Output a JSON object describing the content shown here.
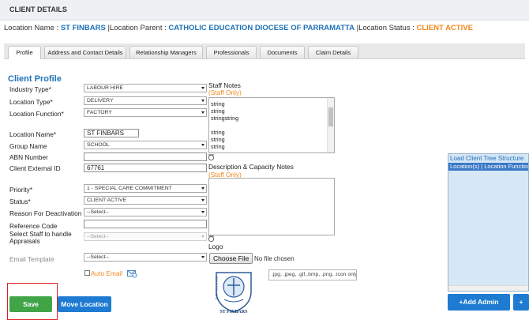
{
  "header": {
    "title": "CLIENT DETAILS"
  },
  "location_line": {
    "name_label": "Location Name : ",
    "name_value": "ST FINBARS",
    "parent_label": "|Location Parent : ",
    "parent_value": "CATHOLIC EDUCATION DIOCESE OF PARRAMATTA",
    "status_label": "|Location Status : ",
    "status_value": "CLIENT ACTIVE"
  },
  "tabs": [
    "Profile",
    "Address and Contact Details",
    "Relationship Managers",
    "Professionals",
    "Documents",
    "Claim Details"
  ],
  "section_title": "Client Profile",
  "fields": {
    "industry_type": {
      "label": "Industry Type*",
      "value": "LABOUR HIRE"
    },
    "location_type": {
      "label": "Location Type*",
      "value": "DELIVERY"
    },
    "location_function": {
      "label": "Location Function*",
      "value": "FACTORY"
    },
    "location_name": {
      "label": "Location Name*",
      "value": "ST FINBARS"
    },
    "group_name": {
      "label": "Group Name",
      "value": "SCHOOL"
    },
    "abn_number": {
      "label": "ABN Number",
      "value": ""
    },
    "client_external_id": {
      "label": "Client External ID",
      "value": "67761"
    },
    "priority": {
      "label": "Priority*",
      "value": "1 - SPECIAL CARE COMMITMENT"
    },
    "status": {
      "label": "Status*",
      "value": "CLIENT ACTIVE"
    },
    "reason_for_deactivation": {
      "label": "Reason For Deactivation",
      "value": "--Select--"
    },
    "reference_code": {
      "label": "Reference Code",
      "value": ""
    },
    "staff_appraisals": {
      "label_line1": "Select Staff to handle",
      "label_line2": "Appraisals",
      "value": "--Select--"
    },
    "email_template": {
      "label": "Email Template",
      "value": "--Select--"
    },
    "auto_email": {
      "label": "Auto Email"
    }
  },
  "staff_notes": {
    "title": "Staff Notes",
    "subtitle": "(Staff Only)",
    "lines": [
      "string",
      "string",
      "stringstring",
      "",
      "string",
      "string",
      "string"
    ]
  },
  "description_notes": {
    "title": "Description & Capacity Notes",
    "subtitle": "(Staff Only)"
  },
  "logo": {
    "label": "Logo",
    "choose_file": "Choose File",
    "no_file": "No file chosen",
    "allowed": ".jpg, .jpeg, .gif,.bmp, .png, .icon only",
    "image_text": "ST FINBARS",
    "image_motto": "SERVE THE LORD"
  },
  "tree_panel": {
    "title": "Load Client Tree Structure",
    "header": "Location(s) | Location Function"
  },
  "buttons": {
    "save": "Save",
    "move_location": "Move Location",
    "add_admin": "+Add Admin",
    "add_more": "+"
  },
  "colors": {
    "accent_blue": "#1f72b8",
    "status_orange": "#f0891c",
    "save_green": "#41a447",
    "button_blue": "#1e7bd1",
    "highlight_red": "#e02020"
  }
}
